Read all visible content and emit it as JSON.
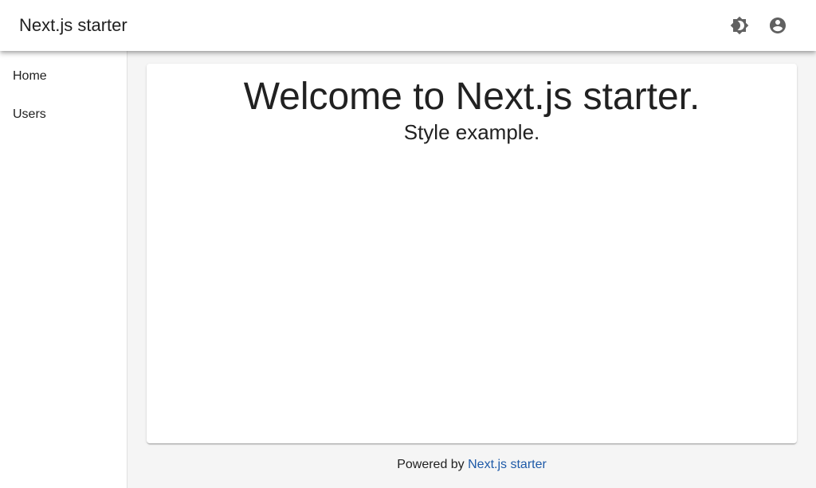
{
  "app": {
    "title": "Next.js starter",
    "icons": {
      "theme_toggle": "brightness-icon",
      "account": "account-circle-icon"
    }
  },
  "sidebar": {
    "items": [
      {
        "label": "Home"
      },
      {
        "label": "Users"
      }
    ]
  },
  "main": {
    "headline": "Welcome to Next.js starter.",
    "subheadline": "Style example."
  },
  "footer": {
    "prefix": "Powered by",
    "link_label": "Next.js starter"
  },
  "colors": {
    "background": "#f5f5f5",
    "surface": "#ffffff",
    "text": "#212121",
    "icon": "#616161",
    "link": "#1e5aa8"
  }
}
